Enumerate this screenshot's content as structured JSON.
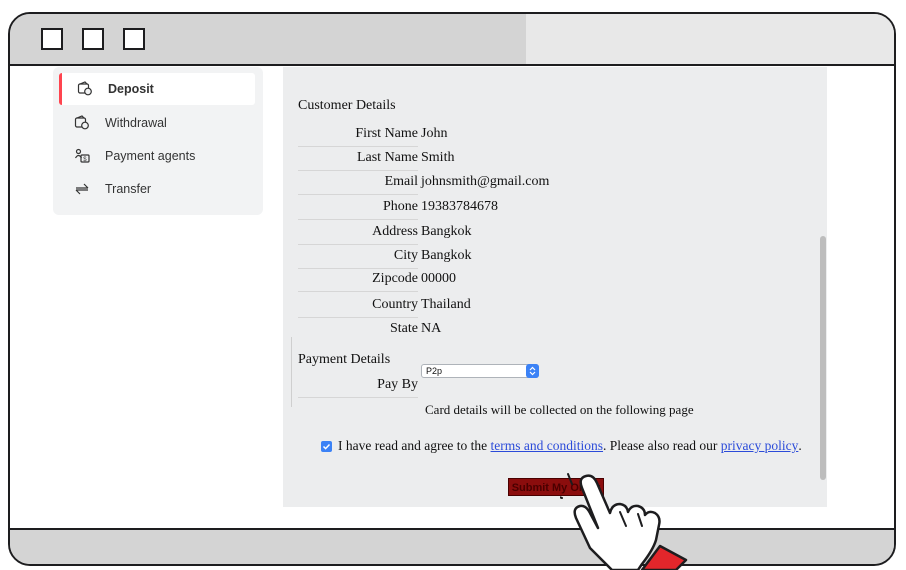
{
  "sidebar": {
    "items": [
      {
        "label": "Deposit",
        "icon": "wallet-icon",
        "active": true
      },
      {
        "label": "Withdrawal",
        "icon": "wallet-icon",
        "active": false
      },
      {
        "label": "Payment agents",
        "icon": "agent-icon",
        "active": false
      },
      {
        "label": "Transfer",
        "icon": "transfer-arrows-icon",
        "active": false
      }
    ]
  },
  "customer": {
    "title": "Customer Details",
    "fields": [
      {
        "label": "First Name",
        "value": "John"
      },
      {
        "label": "Last Name",
        "value": "Smith"
      },
      {
        "label": "Email",
        "value": "johnsmith@gmail.com"
      },
      {
        "label": "Phone",
        "value": "19383784678"
      },
      {
        "label": "Address",
        "value": "Bangkok"
      },
      {
        "label": "City",
        "value": "Bangkok"
      },
      {
        "label": "Zipcode",
        "value": "00000"
      },
      {
        "label": "Country",
        "value": "Thailand"
      },
      {
        "label": "State",
        "value": "NA"
      }
    ]
  },
  "payment": {
    "title": "Payment Details",
    "pay_by_label": "Pay By",
    "pay_by_value": "P2p",
    "note": "Card details will be collected on the following page"
  },
  "agreement": {
    "checked": true,
    "text_before": "I have read and agree to the",
    "terms_link": "terms and conditions",
    "text_middle": ". Please also read our",
    "privacy_link": "privacy policy",
    "text_after": "."
  },
  "submit_label": "Submit My Order",
  "colors": {
    "accent": "#ff444f",
    "submit": "#8b0d0d",
    "link": "#2b4bd9",
    "checkbox": "#3b82f6"
  }
}
